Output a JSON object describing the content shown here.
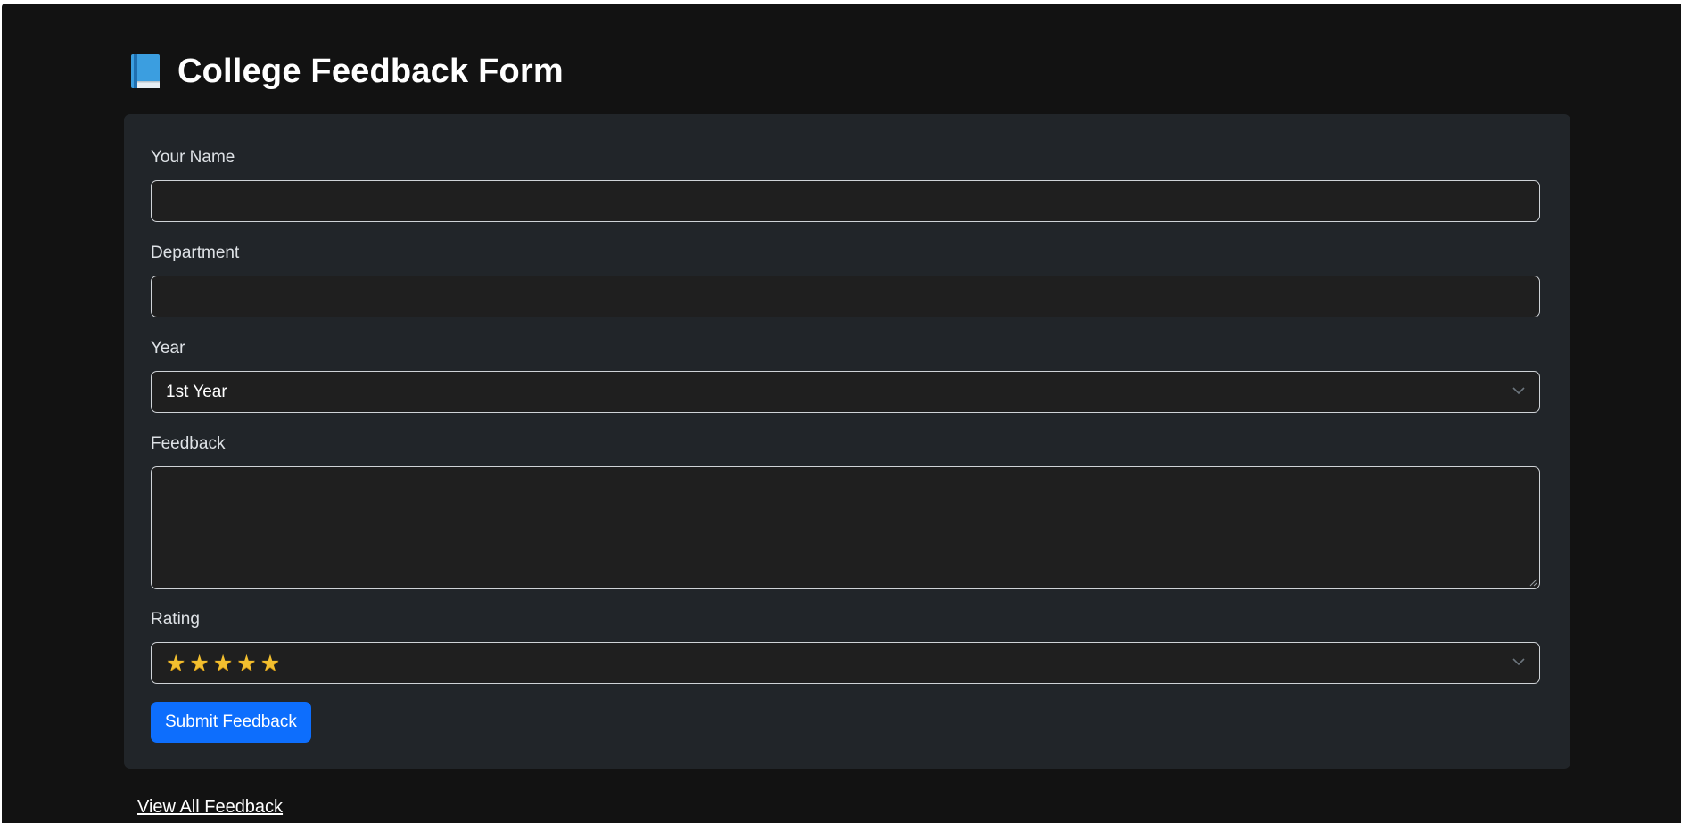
{
  "header": {
    "icon": "blue-book-icon",
    "title": "College Feedback Form"
  },
  "form": {
    "name": {
      "label": "Your Name",
      "value": ""
    },
    "department": {
      "label": "Department",
      "value": ""
    },
    "year": {
      "label": "Year",
      "selected": "1st Year",
      "icon": "chevron-down-icon"
    },
    "feedback": {
      "label": "Feedback",
      "value": ""
    },
    "rating": {
      "label": "Rating",
      "selected": "⭐⭐⭐⭐⭐",
      "stars": 5,
      "icon": "star-icon"
    },
    "submit_label": "Submit Feedback"
  },
  "footer": {
    "view_all_label": "View All Feedback"
  },
  "colors": {
    "background": "#121212",
    "card": "#212529",
    "input": "#1f1f1f",
    "accent": "#0d6efd",
    "star": "#f2bf2f"
  }
}
